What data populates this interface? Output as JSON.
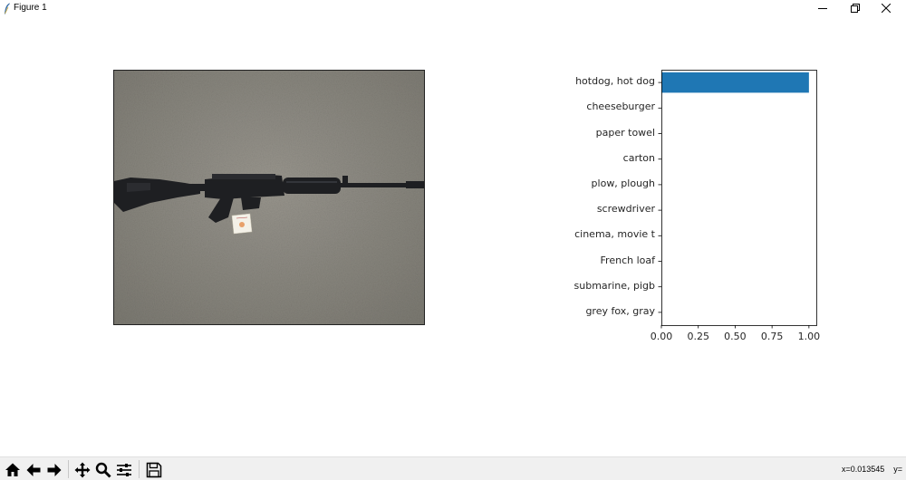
{
  "window": {
    "title": "Figure 1",
    "controls": [
      "minimize-icon",
      "restore-icon",
      "close-icon"
    ]
  },
  "photo": {
    "description_icon": "rifle-photo"
  },
  "chart_data": {
    "type": "bar",
    "orientation": "horizontal",
    "categories": [
      "hotdog, hot dog",
      "cheeseburger",
      "paper towel",
      "carton",
      "plow, plough",
      "screwdriver",
      "cinema, movie t",
      "French loaf",
      "submarine, pigb",
      "grey fox, gray "
    ],
    "values": [
      1.0,
      0.0,
      0.0,
      0.0,
      0.0,
      0.0,
      0.0,
      0.0,
      0.0,
      0.0
    ],
    "xticks": [
      "0.00",
      "0.25",
      "0.50",
      "0.75",
      "1.00"
    ],
    "xlim": [
      0,
      1.05
    ],
    "bar_color": "#1f77b4",
    "grid": false,
    "title": "",
    "xlabel": "",
    "ylabel": ""
  },
  "toolbar": {
    "buttons": [
      "home-icon",
      "back-icon",
      "forward-icon",
      "pan-icon",
      "zoom-icon",
      "configure-subplots-icon",
      "save-icon"
    ],
    "coords": "x=0.013545    y="
  }
}
